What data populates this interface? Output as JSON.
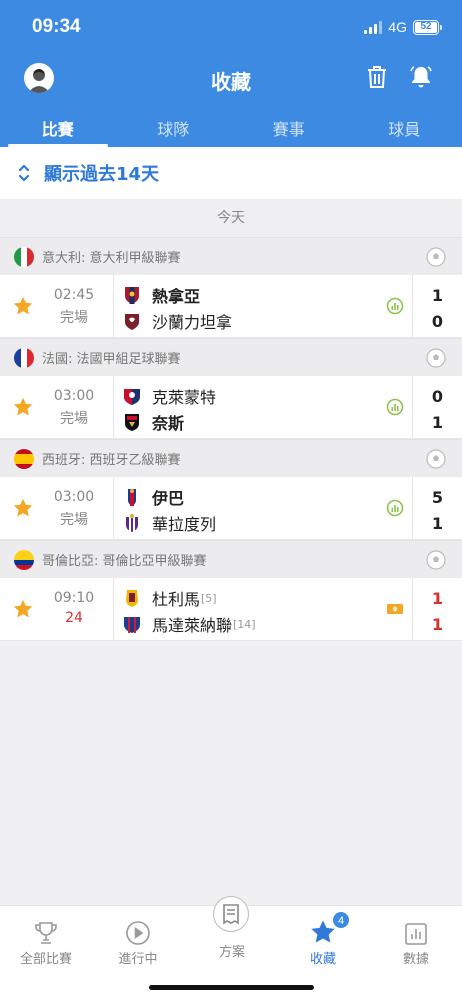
{
  "status_bar": {
    "time": "09:34",
    "network": "4G",
    "battery": "52"
  },
  "header": {
    "title": "收藏"
  },
  "tabs": [
    {
      "label": "比賽",
      "active": true
    },
    {
      "label": "球隊",
      "active": false
    },
    {
      "label": "賽事",
      "active": false
    },
    {
      "label": "球員",
      "active": false
    }
  ],
  "history": {
    "label": "顯示過去14天"
  },
  "section_label": "今天",
  "leagues": [
    {
      "name": "意大利: 意大利甲級聯賽",
      "match": {
        "time": "02:45",
        "status": "完場",
        "home": "熱拿亞",
        "away": "沙蘭力坦拿",
        "home_score": "1",
        "away_score": "0"
      }
    },
    {
      "name": "法國: 法國甲組足球聯賽",
      "match": {
        "time": "03:00",
        "status": "完場",
        "home": "克萊蒙特",
        "away": "奈斯",
        "home_score": "0",
        "away_score": "1"
      }
    },
    {
      "name": "西班牙: 西班牙乙級聯賽",
      "match": {
        "time": "03:00",
        "status": "完場",
        "home": "伊巴",
        "away": "華拉度列",
        "home_score": "5",
        "away_score": "1"
      }
    },
    {
      "name": "哥倫比亞: 哥倫比亞甲級聯賽",
      "match": {
        "time": "09:10",
        "status": "24",
        "home": "杜利馬",
        "home_rank": "[5]",
        "away": "馬達萊納聯",
        "away_rank": "[14]",
        "home_score": "1",
        "away_score": "1"
      }
    }
  ],
  "bottom_nav": {
    "all_matches": "全部比賽",
    "live": "進行中",
    "plans": "方案",
    "favorites": "收藏",
    "favorites_count": "4",
    "stats": "數據"
  },
  "colors": {
    "primary": "#3d8ae3",
    "live_red": "#d9302c",
    "star": "#f5a623"
  }
}
